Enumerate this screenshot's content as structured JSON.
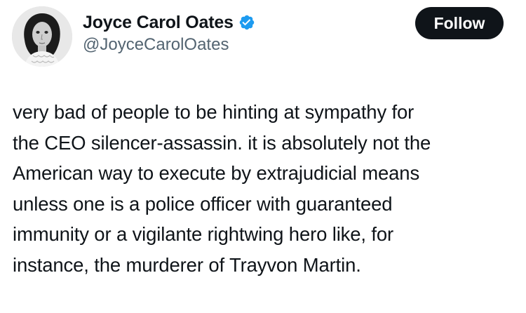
{
  "author": {
    "display_name": "Joyce Carol Oates",
    "handle": "@JoyceCarolOates",
    "verified_icon": "verified-badge-icon",
    "avatar_icon": "profile-photo"
  },
  "actions": {
    "follow_label": "Follow"
  },
  "tweet": {
    "lines": [
      "very bad of people to be hinting at sympathy for",
      "the CEO silencer-assassin. it is absolutely not the",
      "American way to execute by extrajudicial means",
      "unless one is a police officer with guaranteed",
      "immunity or a vigilante rightwing hero like, for",
      "instance, the murderer of Trayvon Martin."
    ]
  },
  "colors": {
    "text": "#0f1419",
    "secondary_text": "#536471",
    "follow_button_bg": "#0f1419",
    "verified_blue": "#1d9bf0"
  }
}
